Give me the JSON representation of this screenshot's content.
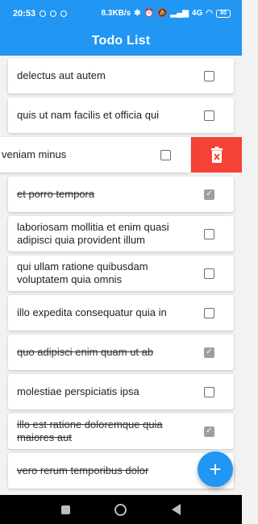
{
  "status_bar": {
    "time": "20:53",
    "network_speed": "8.3KB/s",
    "network_type": "4G",
    "battery": "80"
  },
  "app_bar": {
    "title": "Todo List"
  },
  "todos": [
    {
      "title": "delectus aut autem",
      "completed": false
    },
    {
      "title": "quis ut nam facilis et officia qui",
      "completed": false
    },
    {
      "title": "veniam minus",
      "completed": false,
      "swiped": true
    },
    {
      "title": "et porro tempora",
      "completed": true
    },
    {
      "title": "laboriosam mollitia et enim quasi adipisci quia provident illum",
      "completed": false
    },
    {
      "title": "qui ullam ratione quibusdam voluptatem quia omnis",
      "completed": false
    },
    {
      "title": "illo expedita consequatur quia in",
      "completed": false
    },
    {
      "title": "quo adipisci enim quam ut ab",
      "completed": true
    },
    {
      "title": "molestiae perspiciatis ipsa",
      "completed": false
    },
    {
      "title": "illo est ratione doloremque quia maiores aut",
      "completed": true
    },
    {
      "title": "vero rerum temporibus dolor",
      "completed": true
    }
  ],
  "swipe_action": {
    "icon": "trash-icon",
    "color": "#f44336"
  },
  "fab": {
    "icon": "plus-icon",
    "symbol": "+"
  },
  "colors": {
    "primary": "#2196f3",
    "delete": "#f44336",
    "checked": "#9e9e9e"
  }
}
